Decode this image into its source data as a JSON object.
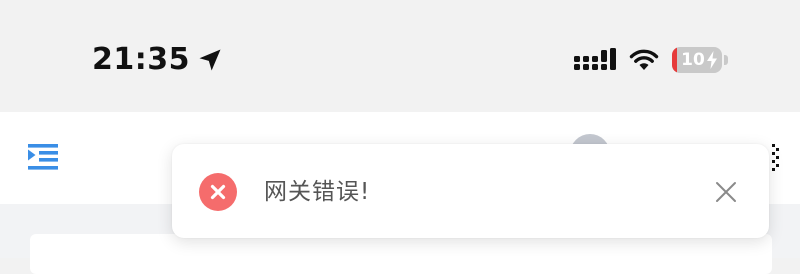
{
  "status_bar": {
    "time": "21:35",
    "battery_level": "10",
    "battery_fraction": 0.1,
    "icons": [
      "location-arrow-icon",
      "cellular-signal-icon",
      "wifi-icon",
      "battery-charging-icon"
    ]
  },
  "header": {
    "icons": [
      "menu-indent-icon",
      "avatar",
      "fullscreen-icon"
    ]
  },
  "toast": {
    "type": "error",
    "message": "网关错误!",
    "icon": "error-circle-icon",
    "close_icon": "close-icon"
  },
  "colors": {
    "accent": "#3a8ee6",
    "error": "#f56c6c",
    "battery_low": "#e63b3b",
    "status_bg": "#f2f2f2",
    "page_bg": "#f2f3f5"
  }
}
